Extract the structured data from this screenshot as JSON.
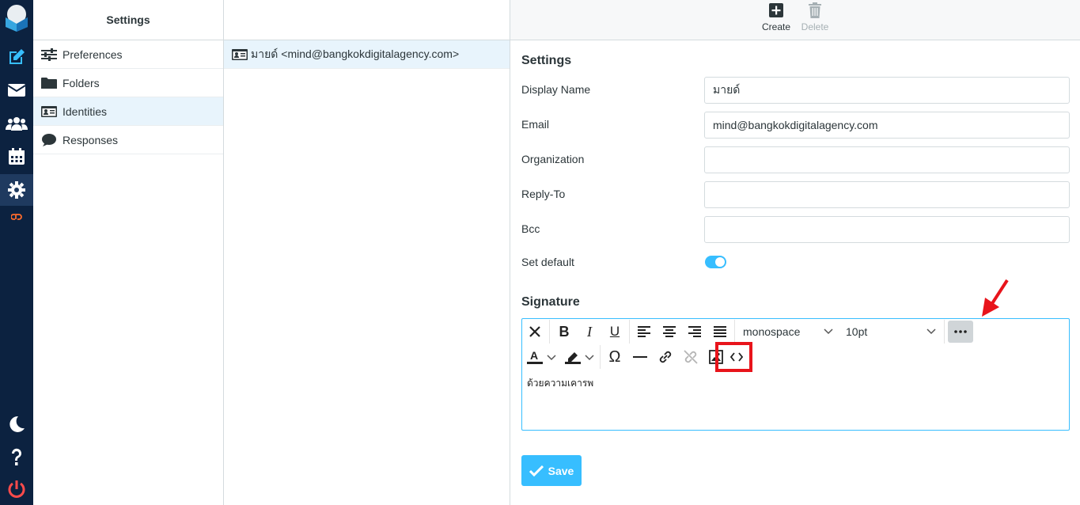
{
  "nav": {
    "items": [
      "compose-icon",
      "mail-icon",
      "contacts-icon",
      "calendar-icon",
      "settings-icon",
      "cpanel-icon",
      "dark-mode-icon",
      "help-icon",
      "logout-icon"
    ]
  },
  "settings_list": {
    "header": "Settings",
    "items": [
      {
        "label": "Preferences",
        "icon": "sliders-icon"
      },
      {
        "label": "Folders",
        "icon": "folder-icon"
      },
      {
        "label": "Identities",
        "icon": "id-card-icon"
      },
      {
        "label": "Responses",
        "icon": "comment-icon"
      }
    ]
  },
  "identities": {
    "items": [
      {
        "label": "มายด์ <mind@bangkokdigitalagency.com>"
      }
    ]
  },
  "toolbar": {
    "create_label": "Create",
    "delete_label": "Delete"
  },
  "form": {
    "title": "Settings",
    "fields": [
      {
        "label": "Display Name",
        "value": "มายด์"
      },
      {
        "label": "Email",
        "value": "mind@bangkokdigitalagency.com"
      },
      {
        "label": "Organization",
        "value": ""
      },
      {
        "label": "Reply-To",
        "value": ""
      },
      {
        "label": "Bcc",
        "value": ""
      }
    ],
    "set_default_label": "Set default",
    "signature_title": "Signature",
    "editor": {
      "font_family": "monospace",
      "font_size": "10pt",
      "content": "ด้วยความเคารพ"
    },
    "save_label": "Save"
  },
  "colors": {
    "nav_bg": "#0c2240",
    "accent": "#37beff",
    "annotation": "#e8141b"
  }
}
